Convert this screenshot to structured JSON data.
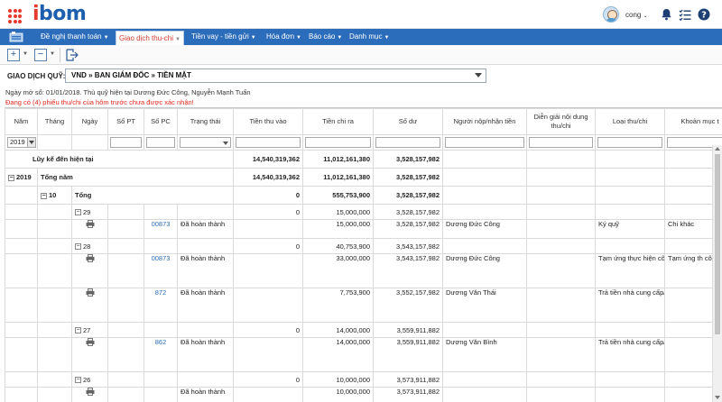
{
  "header": {
    "logo_first": "i",
    "logo_rest": "bom",
    "user_name": "cong"
  },
  "nav": {
    "items": [
      {
        "label": "Đề nghị thanh toán",
        "active": false
      },
      {
        "label": "Giao dịch thu-chi",
        "active": true
      },
      {
        "label": "Tiền vay - tiền gửi",
        "active": false
      },
      {
        "label": "Hóa đơn",
        "active": false
      },
      {
        "label": "Báo cáo",
        "active": false
      },
      {
        "label": "Danh mục",
        "active": false
      }
    ]
  },
  "filter": {
    "label": "GIAO DỊCH QUỸ:",
    "selected": "VND » BAN GIÁM ĐỐC » TIỀN MẶT",
    "info": "Ngày mở sổ: 01/01/2018. Thủ quỹ hiện tại Dương Đức Công, Nguyễn Mạnh Tuấn",
    "warning": "Đang có (4) phiếu thu/chi của hôm trước chưa được xác nhận!"
  },
  "table": {
    "headers": {
      "year": "Năm",
      "month": "Tháng",
      "day": "Ngày",
      "so_pt": "Số PT",
      "so_pc": "Số PC",
      "status": "Trạng thái",
      "in": "Tiền thu vào",
      "out": "Tiền chi ra",
      "balance": "Số dư",
      "person": "Người nộp/nhận tiền",
      "desc": "Diễn giải nội dung thu/chi",
      "type": "Loại thu/chi",
      "item": "Khoản mục t"
    },
    "year_filter": "2019",
    "summary": {
      "label": "Lũy kế đến hiện tại",
      "in": "14,540,319,362",
      "out": "11,012,161,380",
      "balance": "3,528,157,982"
    },
    "year_row": {
      "year": "2019",
      "label": "Tổng năm",
      "in": "14,540,319,362",
      "out": "11,012,161,380",
      "balance": "3,528,157,982"
    },
    "month_row": {
      "month": "10",
      "label": "Tổng",
      "in": "0",
      "out": "555,753,900",
      "balance": "3,528,157,982"
    },
    "rows": [
      {
        "kind": "day",
        "day": "29",
        "in": "0",
        "out": "15,000,000",
        "balance": "3,528,157,982"
      },
      {
        "kind": "doc",
        "pc": "00873",
        "status": "Đã hoàn thành",
        "in": "",
        "out": "15,000,000",
        "balance": "3,528,157,982",
        "person": "Dương Đức Công",
        "desc": "",
        "type": "Ký quỹ",
        "item": "Chi khác"
      },
      {
        "kind": "day",
        "day": "28",
        "in": "0",
        "out": "40,753,900",
        "balance": "3,543,157,982"
      },
      {
        "kind": "doc",
        "pc": "00873",
        "status": "Đã hoàn thành",
        "in": "",
        "out": "33,000,000",
        "balance": "3,543,157,982",
        "person": "Dương Đức Công",
        "desc": "",
        "type": "Tạm ứng thực hiện công việc/công tác khác",
        "item": "Tạm ứng th công việc"
      },
      {
        "kind": "doc",
        "pc": "872",
        "status": "Đã hoàn thành",
        "in": "",
        "out": "7,753,900",
        "balance": "3,552,157,982",
        "person": "Dương Văn Thái",
        "desc": "",
        "type": "Trả tiền nhà cung cấp/nhà thầu",
        "item": ""
      },
      {
        "kind": "day",
        "day": "27",
        "in": "0",
        "out": "14,000,000",
        "balance": "3,559,911,882"
      },
      {
        "kind": "doc",
        "pc": "862",
        "status": "Đã hoàn thành",
        "in": "",
        "out": "14,000,000",
        "balance": "3,559,911,882",
        "person": "Dương Văn Bình",
        "desc": "",
        "type": "Trả tiền nhà cung cấp/nhà thầu",
        "item": ""
      },
      {
        "kind": "day",
        "day": "26",
        "in": "0",
        "out": "10,000,000",
        "balance": "3,573,911,882"
      },
      {
        "kind": "doc",
        "pc": "",
        "status": "Đã hoàn thành",
        "in": "",
        "out": "10,000,000",
        "balance": "3,573,911,882",
        "person": "",
        "desc": "",
        "type": "",
        "item": ""
      }
    ]
  }
}
